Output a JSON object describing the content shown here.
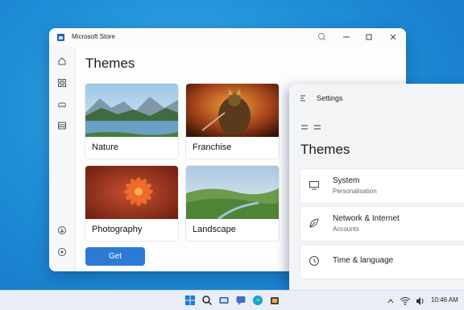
{
  "store": {
    "window_title": "Microsoft Store",
    "page_title": "Themes",
    "cards": [
      {
        "label": "Nature"
      },
      {
        "label": "Franchise"
      },
      {
        "label": "Photography"
      },
      {
        "label": "Landscape"
      }
    ],
    "get_label": "Get",
    "nav_icons": [
      "home-icon",
      "apps-icon",
      "gaming-icon",
      "library-icon",
      "downloads-icon",
      "help-icon"
    ],
    "accent": "#2d7ad6"
  },
  "settings": {
    "window_title": "Settings",
    "heading": "Themes",
    "items": [
      {
        "label": "System",
        "sub": "Personalisation",
        "icon": "monitor-icon"
      },
      {
        "label": "Network & Internet",
        "sub": "Accounts",
        "icon": "leaf-icon"
      },
      {
        "label": "Time & language",
        "sub": "",
        "icon": "clock-icon"
      }
    ]
  },
  "taskbar": {
    "time": "10:46 AM",
    "icons": [
      "start-icon",
      "search-icon",
      "task-view-icon",
      "chat-icon",
      "explorer-icon",
      "edge-icon",
      "store-icon"
    ]
  }
}
